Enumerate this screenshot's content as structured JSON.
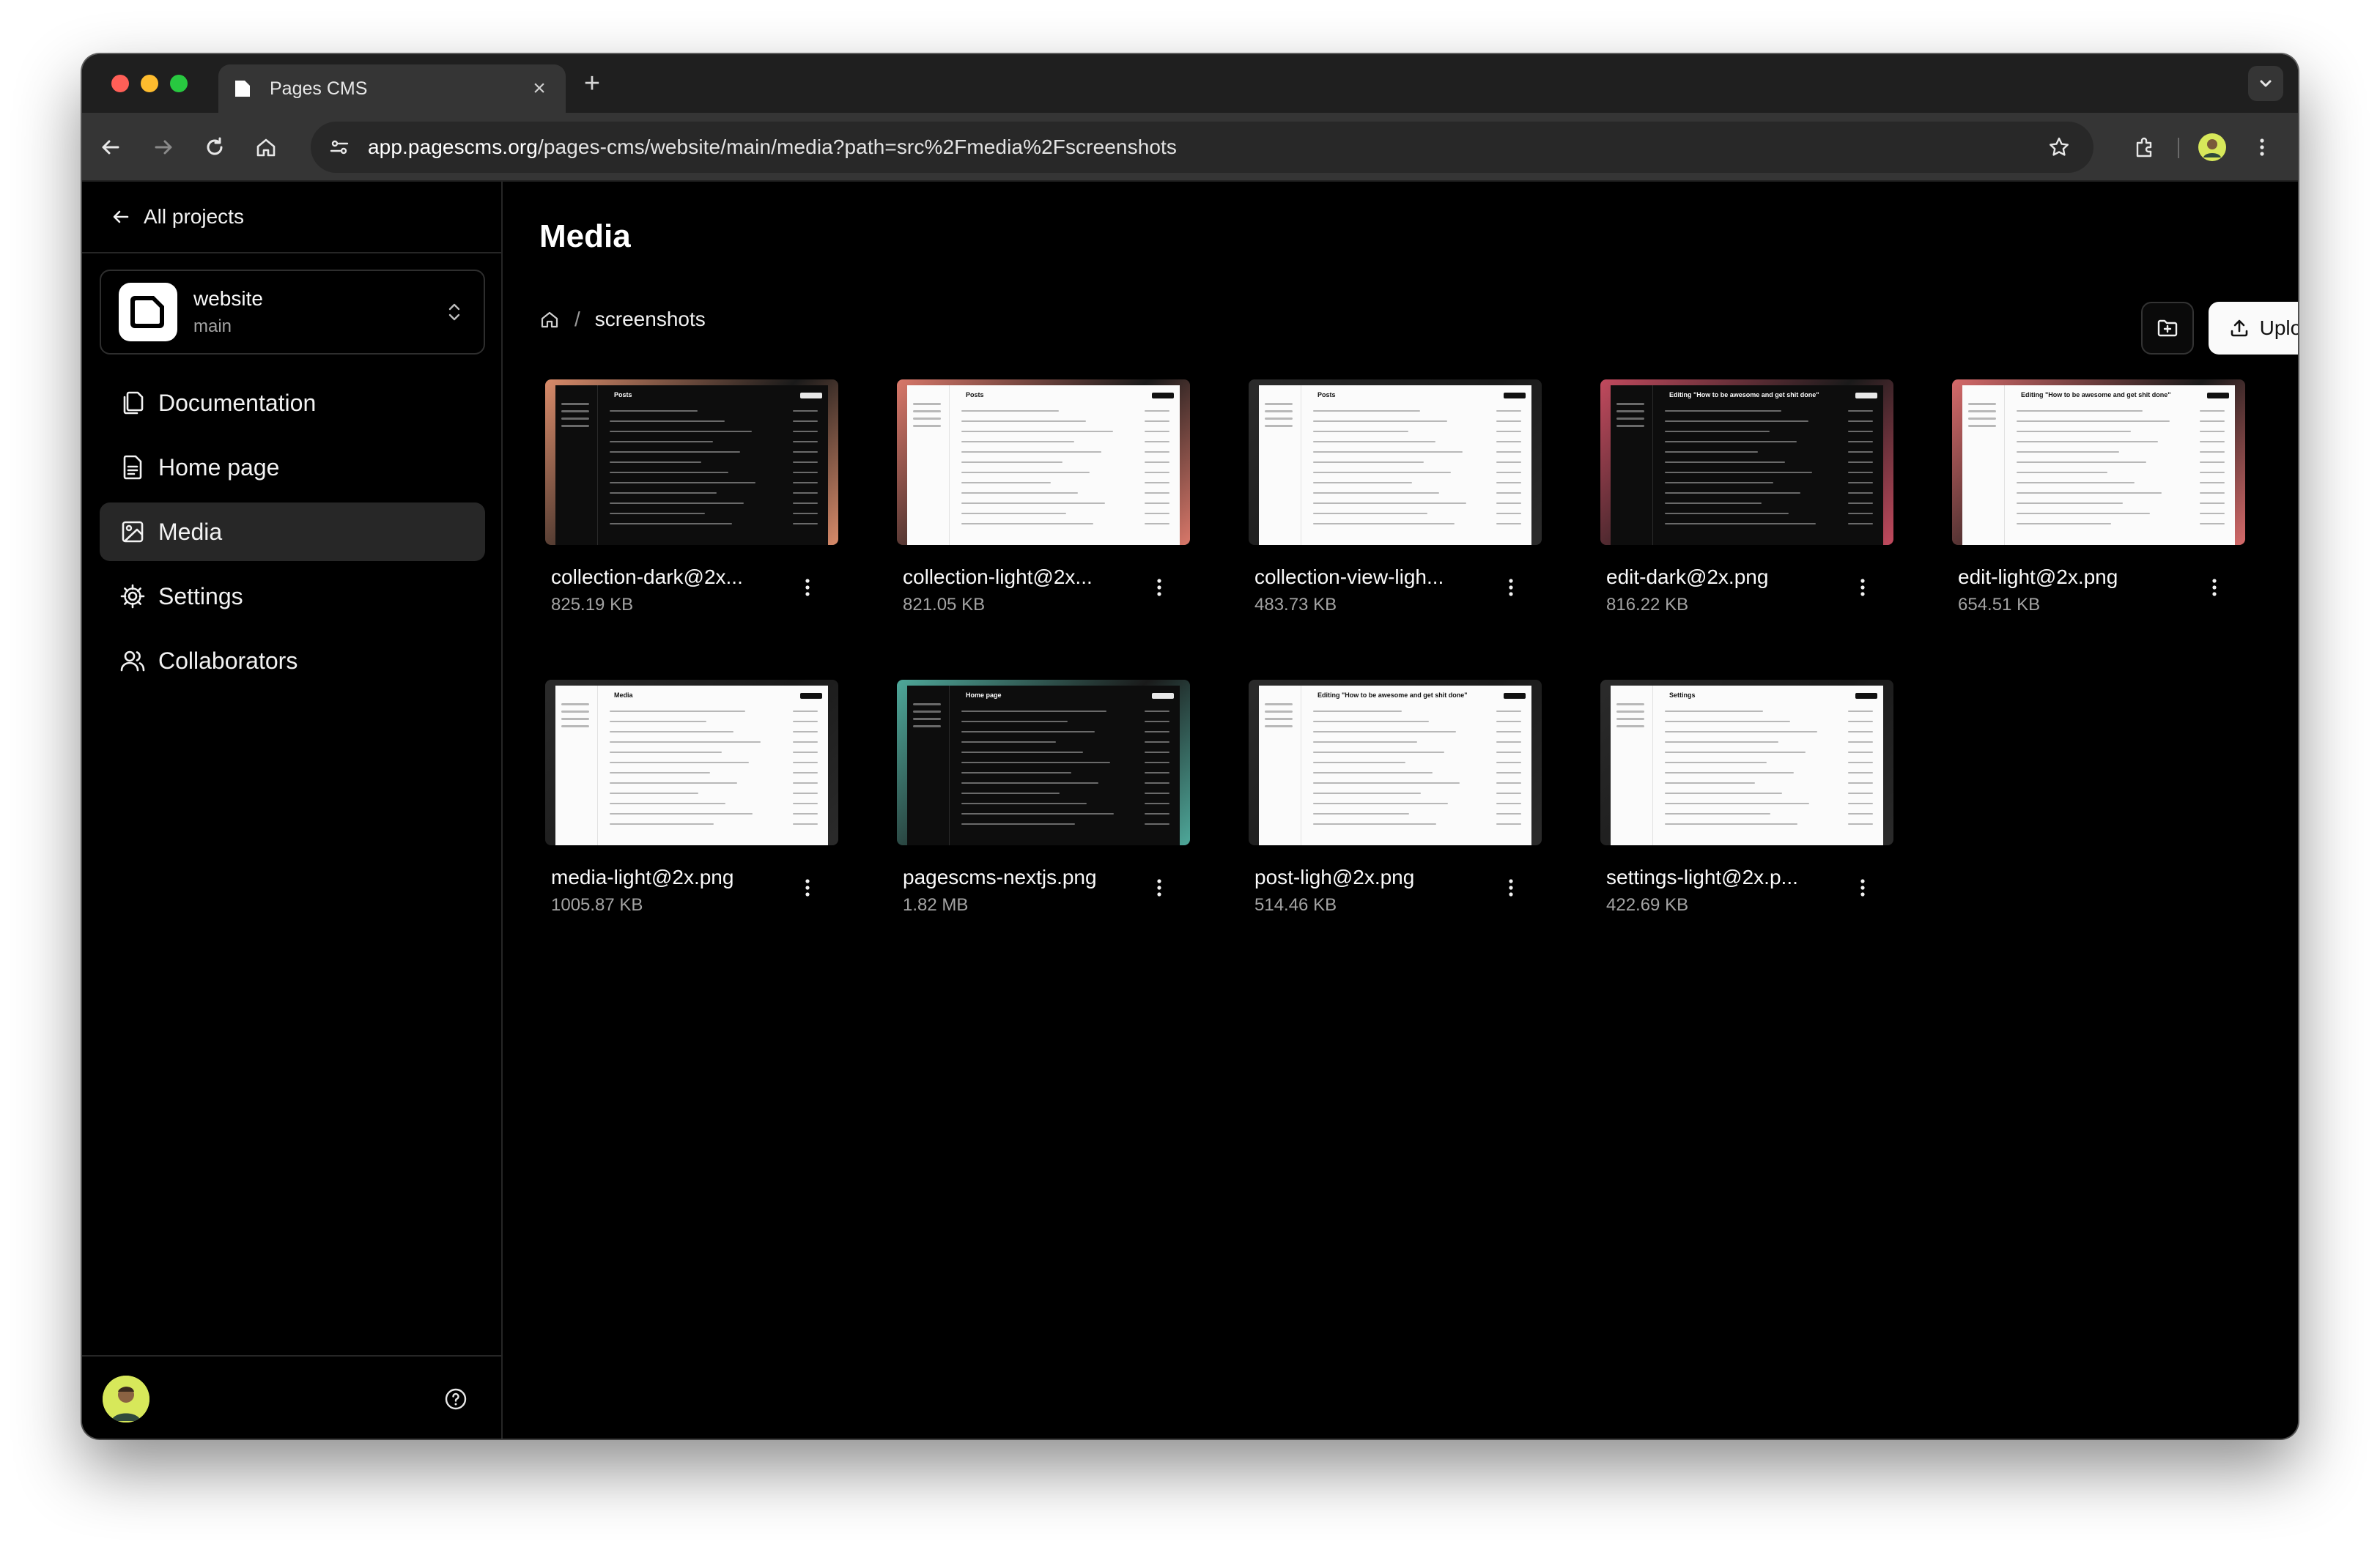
{
  "browser": {
    "tab_title": "Pages CMS",
    "url_host": "app.pagescms.org",
    "url_path": "/pages-cms/website/main/media?path=src%2Fmedia%2Fscreenshots"
  },
  "sidebar": {
    "back_label": "All projects",
    "project": {
      "name": "website",
      "branch": "main"
    },
    "items": [
      {
        "label": "Documentation",
        "icon": "documents-icon"
      },
      {
        "label": "Home page",
        "icon": "file-text-icon"
      },
      {
        "label": "Media",
        "icon": "image-icon",
        "active": true
      },
      {
        "label": "Settings",
        "icon": "gear-icon"
      },
      {
        "label": "Collaborators",
        "icon": "users-icon"
      }
    ]
  },
  "main": {
    "title": "Media",
    "breadcrumb": {
      "current": "screenshots"
    },
    "upload_label": "Upload",
    "files": [
      {
        "name": "collection-dark@2x...",
        "size": "825.19 KB",
        "theme": "dark",
        "accent": "#d98b6a",
        "thumb_title": "Posts"
      },
      {
        "name": "collection-light@2x...",
        "size": "821.05 KB",
        "theme": "light",
        "accent": "#d9786a",
        "thumb_title": "Posts"
      },
      {
        "name": "collection-view-ligh...",
        "size": "483.73 KB",
        "theme": "light",
        "accent": "#2b2b2b",
        "thumb_title": "Posts"
      },
      {
        "name": "edit-dark@2x.png",
        "size": "816.22 KB",
        "theme": "dark",
        "accent": "#c24a5e",
        "thumb_title": "Editing \"How to be awesome and get shit done\""
      },
      {
        "name": "edit-light@2x.png",
        "size": "654.51 KB",
        "theme": "light",
        "accent": "#d56a6a",
        "thumb_title": "Editing \"How to be awesome and get shit done\""
      },
      {
        "name": "media-light@2x.png",
        "size": "1005.87 KB",
        "theme": "light",
        "accent": "#2b2b2b",
        "thumb_title": "Media"
      },
      {
        "name": "pagescms-nextjs.png",
        "size": "1.82 MB",
        "theme": "dark",
        "accent": "#4ea89a",
        "thumb_title": "Home page"
      },
      {
        "name": "post-ligh@2x.png",
        "size": "514.46 KB",
        "theme": "light",
        "accent": "#2b2b2b",
        "thumb_title": "Editing \"How to be awesome and get shit done\""
      },
      {
        "name": "settings-light@2x.p...",
        "size": "422.69 KB",
        "theme": "light",
        "accent": "#2b2b2b",
        "thumb_title": "Settings"
      }
    ]
  }
}
